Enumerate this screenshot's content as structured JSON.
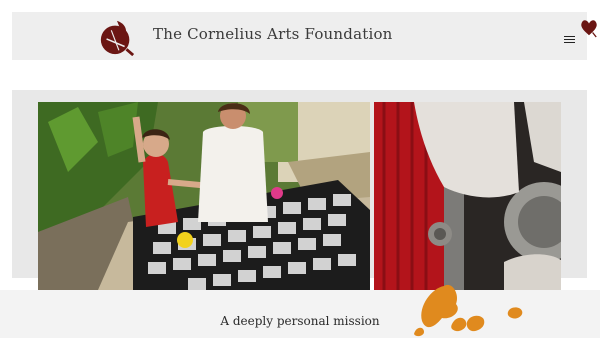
{
  "header": {
    "title": "The Cornelius Arts Foundation",
    "logo_icon": "cornelius-logo-icon",
    "menu_icon": "hamburger-menu-icon",
    "favorite_icon": "heart-icon",
    "brand_color": "#6b1613"
  },
  "hero": {
    "left_photo": "child-and-woman-with-photo-grid-photo",
    "right_photo": "gloved-hands-on-camera-photo"
  },
  "mission": {
    "text": "A deeply personal mission",
    "accent_color": "#e08a1e"
  }
}
